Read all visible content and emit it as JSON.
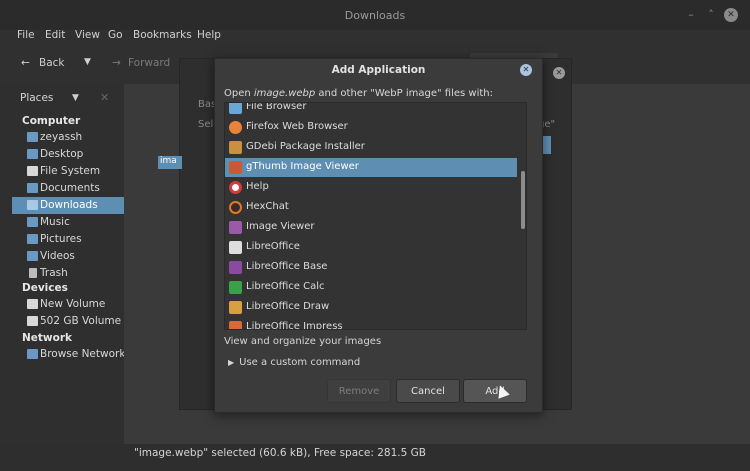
{
  "window": {
    "title": "Downloads"
  },
  "menu": [
    "File",
    "Edit",
    "View",
    "Go",
    "Bookmarks",
    "Help"
  ],
  "toolbar": {
    "back": "Back",
    "forward": "Forward"
  },
  "sidebar": {
    "places_label": "Places",
    "sections": {
      "computer": "Computer",
      "devices": "Devices",
      "network": "Network"
    },
    "computer_items": [
      {
        "label": "zeyassh",
        "icon": "folder-icon"
      },
      {
        "label": "Desktop",
        "icon": "folder-icon"
      },
      {
        "label": "File System",
        "icon": "drive-icon"
      },
      {
        "label": "Documents",
        "icon": "folder-icon"
      },
      {
        "label": "Downloads",
        "icon": "folder-icon",
        "selected": true
      },
      {
        "label": "Music",
        "icon": "folder-icon"
      },
      {
        "label": "Pictures",
        "icon": "folder-icon"
      },
      {
        "label": "Videos",
        "icon": "folder-icon"
      },
      {
        "label": "Trash",
        "icon": "trash-icon"
      }
    ],
    "device_items": [
      {
        "label": "New Volume",
        "icon": "drive-icon"
      },
      {
        "label": "502 GB Volume",
        "icon": "drive-icon"
      }
    ],
    "network_items": [
      {
        "label": "Browse Network",
        "icon": "network-icon"
      }
    ]
  },
  "status": "\"image.webp\" selected (60.6 kB), Free space: 281.5 GB",
  "bg_dialog": {
    "tab": "Bas",
    "select_left": "Sele",
    "select_right": "ge\"",
    "chip": "ima"
  },
  "modal": {
    "title": "Add Application",
    "prompt_prefix": "Open ",
    "prompt_file": "image.webp",
    "prompt_suffix": " and other \"WebP image\" files with:",
    "apps": [
      {
        "name": "File Browser",
        "icon": "file-browser-icon",
        "color": "#6aa6d6"
      },
      {
        "name": "Firefox Web Browser",
        "icon": "firefox-icon",
        "color": "#e8843a"
      },
      {
        "name": "GDebi Package Installer",
        "icon": "package-icon",
        "color": "#c9913f"
      },
      {
        "name": "gThumb Image Viewer",
        "icon": "gthumb-icon",
        "color": "#c85a3a",
        "selected": true
      },
      {
        "name": "Help",
        "icon": "help-icon",
        "color": "#d63a3a"
      },
      {
        "name": "HexChat",
        "icon": "hexchat-icon",
        "color": "#e07a2a"
      },
      {
        "name": "Image Viewer",
        "icon": "image-viewer-icon",
        "color": "#9a5aa8"
      },
      {
        "name": "LibreOffice",
        "icon": "libreoffice-icon",
        "color": "#dddddd"
      },
      {
        "name": "LibreOffice Base",
        "icon": "libreoffice-base-icon",
        "color": "#8a4aa0"
      },
      {
        "name": "LibreOffice Calc",
        "icon": "libreoffice-calc-icon",
        "color": "#3aa04a"
      },
      {
        "name": "LibreOffice Draw",
        "icon": "libreoffice-draw-icon",
        "color": "#d8a040"
      },
      {
        "name": "LibreOffice Impress",
        "icon": "libreoffice-impress-icon",
        "color": "#d86a3a"
      }
    ],
    "description": "View and organize your images",
    "custom_command": "Use a custom command",
    "buttons": {
      "remove": "Remove",
      "cancel": "Cancel",
      "add": "Add"
    }
  },
  "colors": {
    "accent": "#5e8fb3",
    "folder": "#6a9ac4"
  }
}
